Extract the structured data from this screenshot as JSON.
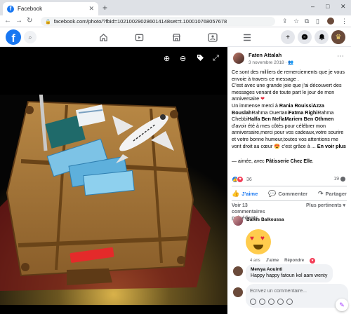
{
  "browser": {
    "tab_title": "Facebook",
    "new_tab_symbol": "+",
    "url": "facebook.com/photo/?fbid=102100290286014148set=t.100010768057678",
    "window_controls": [
      "–",
      "□",
      "✕"
    ]
  },
  "fbnav": {
    "logo": "f",
    "icons": [
      "home-icon",
      "watch-icon",
      "marketplace-icon",
      "groups-icon",
      "menu-icon"
    ],
    "right_buttons": [
      "create-icon",
      "messenger-icon",
      "notifications-icon",
      "profile-avatar"
    ]
  },
  "viewer": {
    "tools": [
      "zoom-in-icon",
      "zoom-out-icon",
      "tag-icon",
      "fullscreen-icon"
    ]
  },
  "post": {
    "author": "Faten Attalah",
    "date": "3 novembre 2018 · ",
    "paragraph_1": "Ce sont des milliers de remerciements que je vous envoie à travers ce message .",
    "paragraph_2": "C'est avec une grande joie que j'ai découvert des messages venant de toute part le jour de mon anniversaire",
    "paragraph_3_pre": "Un immense merci à ",
    "paragraph_3_name_1": "Rania RouissiAzza Bouslah",
    "paragraph_3_mid_1": "Rahma Ouertani",
    "paragraph_3_name_2": "Fatma Righi",
    "paragraph_3_mid_2": "Rahma Chebbi",
    "paragraph_3_name_3": "Halfa Ben NeflaMariem Ben Othmen",
    "paragraph_3_post": " d'avoir été à mes côtés pour célébrer mon anniversaire,merci pour vos cadeaux,votre sourire et votre bonne humeur,toutes vos attentions me vont droit au cœur",
    "paragraph_3_end": " c'est grâce à ...",
    "see_more": "En voir plus",
    "tag_pre": "— aimée, avec ",
    "tag_place": "Pâtisserie Chez Elle",
    "tag_post": "."
  },
  "stats": {
    "reactions_count": "36",
    "comments_count": "19"
  },
  "actions": {
    "like": "J'aime",
    "comment": "Commenter",
    "share": "Partager"
  },
  "comments_header": {
    "previous": "Voir 13 commentaires précédents",
    "sort": "Plus pertinents ▾"
  },
  "comments": [
    {
      "author": "Balkis Balkoussa",
      "age": "4 ans",
      "like": "J'aime",
      "reply": "Répondre"
    },
    {
      "author": "Mewya Aouinti",
      "text": "Happy happy fatoun kol aam wenty"
    }
  ],
  "composer": {
    "placeholder": "Écrivez un commentaire..."
  }
}
